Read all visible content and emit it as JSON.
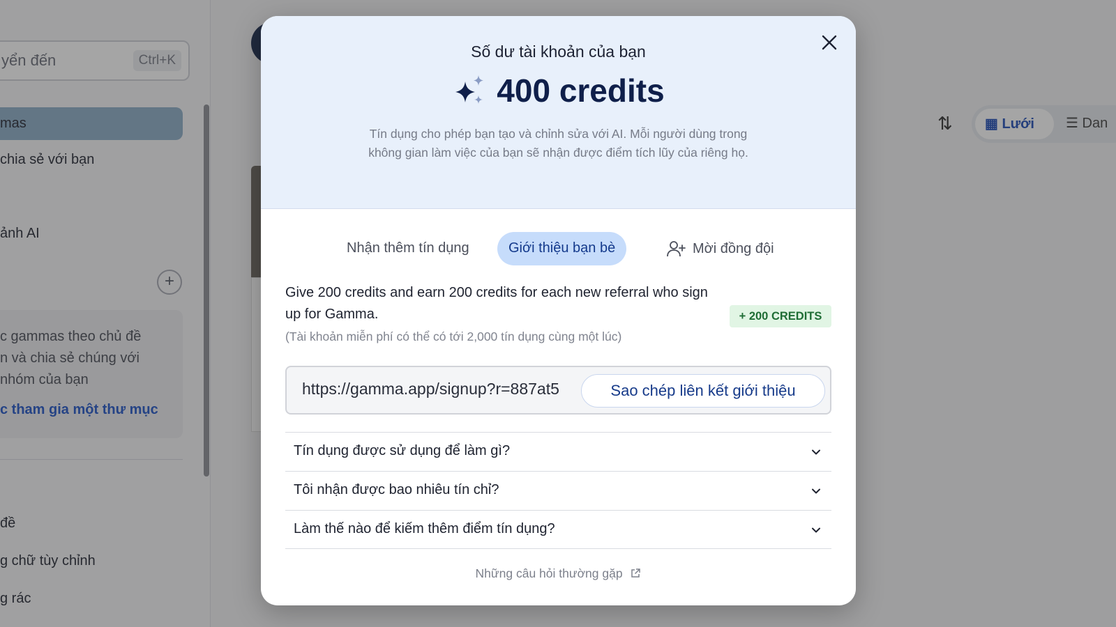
{
  "sidebar": {
    "search_placeholder": "yển đến",
    "search_shortcut": "Ctrl+K",
    "items": [
      {
        "label": "mas"
      },
      {
        "label": " chia sẻ với bạn"
      },
      {
        "label": "ảnh AI"
      },
      {
        "label": "đề"
      },
      {
        "label": "g chữ tùy chỉnh"
      },
      {
        "label": "g rác"
      }
    ],
    "card_lines": [
      "c gammas theo chủ đề",
      "n và chia sẻ chúng với",
      " nhóm của bạn"
    ],
    "card_link": "c tham gia một thư mục"
  },
  "toolbar": {
    "grid_label": "Lưới",
    "list_label": "Dan"
  },
  "modal": {
    "title": "Số dư tài khoản của bạn",
    "credits": "400 credits",
    "description": "Tín dụng cho phép bạn tạo và chỉnh sửa với AI. Mỗi người dùng trong không gian làm việc của bạn sẽ nhận được điểm tích lũy của riêng họ.",
    "tabs": [
      {
        "label": "Nhận thêm tín dụng",
        "active": false
      },
      {
        "label": "Giới thiệu bạn bè",
        "active": true
      },
      {
        "label": "Mời đồng đội",
        "active": false,
        "icon": "add-user-icon"
      }
    ],
    "referral_text": "Give 200 credits and earn 200 credits for each new referral who sign up for Gamma.",
    "referral_note": "(Tài khoản miễn phí có thể có tới 2,000 tín dụng cùng một lúc)",
    "badge": "+ 200 CREDITS",
    "referral_link": "https://gamma.app/signup?r=887at5",
    "copy_label": "Sao chép liên kết giới thiệu",
    "faq": [
      {
        "question": "Tín dụng được sử dụng để làm gì?"
      },
      {
        "question": "Tôi nhận được bao nhiêu tín chỉ?"
      },
      {
        "question": "Làm thế nào để kiếm thêm điểm tín dụng?"
      }
    ],
    "faq_link": "Những câu hỏi thường gặp"
  },
  "colors": {
    "accent": "#143a8c",
    "active_tab_bg": "#c6dcfb",
    "header_bg": "#e8f0fb",
    "badge_bg": "#e1f5e4",
    "badge_text": "#1f6d35"
  }
}
